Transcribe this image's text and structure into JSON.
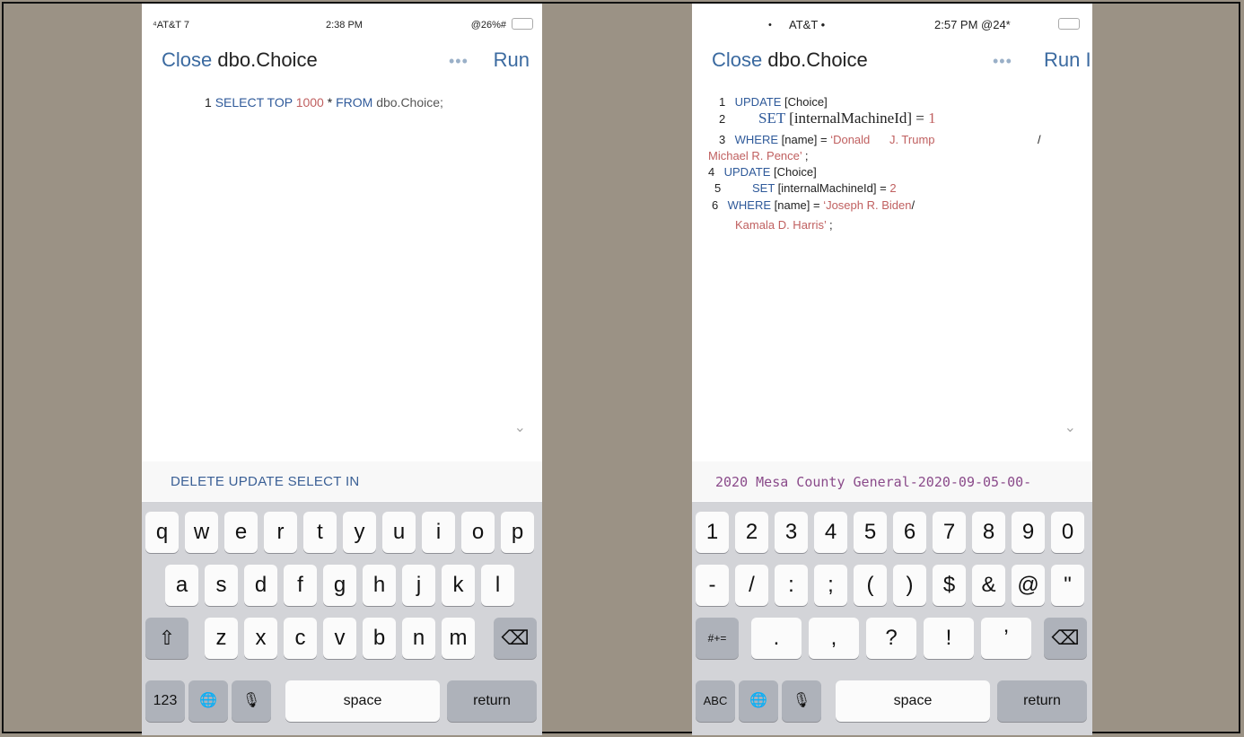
{
  "left": {
    "status": {
      "carrier": "⁴AT&T 7",
      "time": "2:38 PM",
      "battery": "@26%#"
    },
    "nav": {
      "close": "Close",
      "title": "dbo.Choice",
      "more": "•••",
      "run": "Run"
    },
    "code": {
      "line_no": "1",
      "select": "SELECT TOP",
      "limit": "1000",
      "star": " * ",
      "from": "FROM",
      "table": "dbo.Choice;"
    },
    "suggestions": "DELETE UPDATE SELECT IN",
    "keyboard": {
      "row1": [
        "q",
        "w",
        "e",
        "r",
        "t",
        "y",
        "u",
        "i",
        "o",
        "p"
      ],
      "row2": [
        "a",
        "s",
        "d",
        "f",
        "g",
        "h",
        "j",
        "k",
        "l"
      ],
      "row3": [
        "z",
        "x",
        "c",
        "v",
        "b",
        "n",
        "m"
      ],
      "shift": "⇧",
      "backspace": "⌫",
      "mode": "123",
      "globe": "🌐",
      "mic": "🎙",
      "space": "space",
      "return": "return"
    }
  },
  "right": {
    "status": {
      "dot1": "•",
      "carrier": "AT&T •",
      "time_battery": "2:57 PM @24*"
    },
    "nav": {
      "close": "Close",
      "title": "dbo.Choice",
      "more": "•••",
      "run": "Run I"
    },
    "code": {
      "l1": {
        "no": "1",
        "kw": "UPDATE",
        "rest": " [Choice]"
      },
      "l2": {
        "no": "2",
        "kw": "SET",
        "rest": " [internalMachineId] = ",
        "val": "1"
      },
      "l3": {
        "no": "3",
        "kw": "WHERE",
        "rest": " [name] = ",
        "val": "‘Donald      J. Trump",
        "slash": "/"
      },
      "l3b": {
        "val": "Michael R. Pence’",
        "end": " ;"
      },
      "l4": {
        "no": "4",
        "kw": "UPDATE",
        "rest": " [Choice]"
      },
      "l5": {
        "no": "5",
        "kw": "SET",
        "rest": " [internalMachineId] = ",
        "val": "2"
      },
      "l6": {
        "no": "6",
        "kw": "WHERE",
        "rest": " [name] = ",
        "val": "‘Joseph R. Biden",
        "slash": "/"
      },
      "l6b": {
        "val": "Kamala D. Harris’",
        "end": " ;"
      }
    },
    "suggestions": "2020 Mesa County General-2020-09-05-00-",
    "keyboard": {
      "row1": [
        "1",
        "2",
        "3",
        "4",
        "5",
        "6",
        "7",
        "8",
        "9",
        "0"
      ],
      "row2": [
        "-",
        "/",
        ":",
        ";",
        "(",
        ")",
        "$",
        "&",
        "@",
        "\""
      ],
      "row3": [
        ".",
        ",",
        "?",
        "!",
        "’"
      ],
      "symbols": "#+=",
      "backspace": "⌫",
      "mode": "ABC",
      "globe": "🌐",
      "mic": "🎙",
      "space": "space",
      "return": "return"
    }
  }
}
